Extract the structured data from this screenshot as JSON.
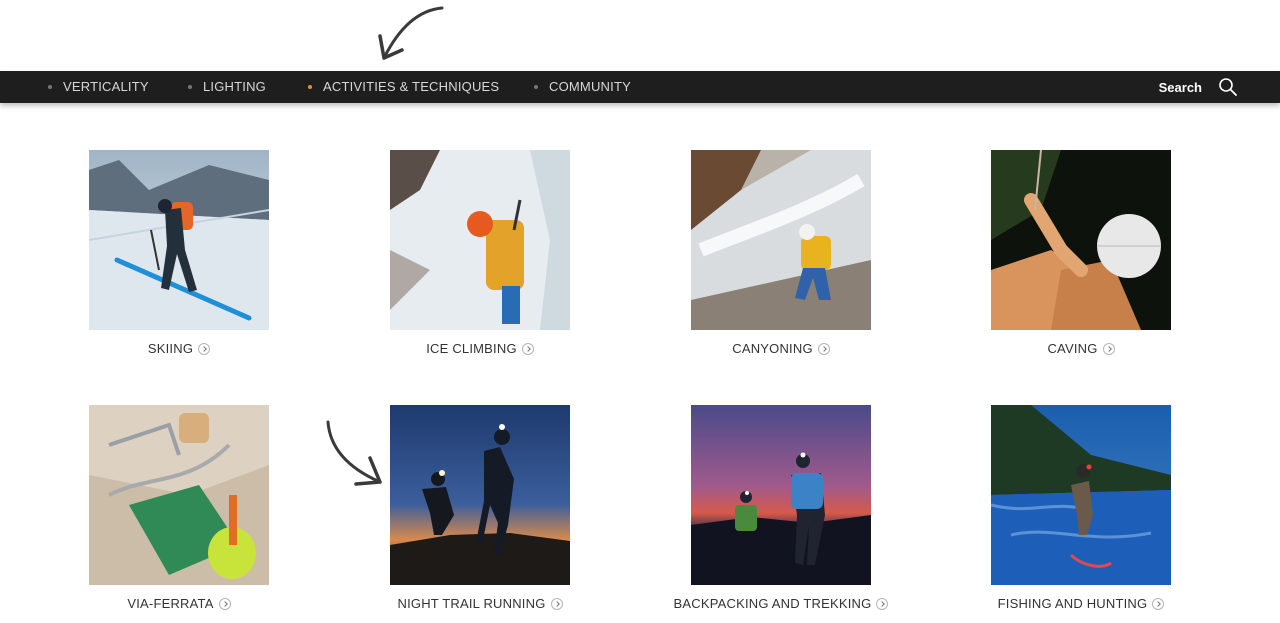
{
  "nav": {
    "items": [
      {
        "label": "VERTICALITY",
        "active": false
      },
      {
        "label": "LIGHTING",
        "active": false
      },
      {
        "label": "ACTIVITIES & TECHNIQUES",
        "active": true
      },
      {
        "label": "COMMUNITY",
        "active": false
      }
    ],
    "search_label": "Search",
    "active_color": "#e8922a",
    "background": "#1e1e1e"
  },
  "activities": [
    {
      "label": "SKIING",
      "icon": "chevron-right-icon"
    },
    {
      "label": "ICE CLIMBING",
      "icon": "chevron-right-icon"
    },
    {
      "label": "CANYONING",
      "icon": "chevron-right-icon"
    },
    {
      "label": "CAVING",
      "icon": "chevron-right-icon"
    },
    {
      "label": "VIA-FERRATA",
      "icon": "chevron-right-icon"
    },
    {
      "label": "NIGHT TRAIL RUNNING",
      "icon": "chevron-right-icon"
    },
    {
      "label": "BACKPACKING AND TREKKING",
      "icon": "chevron-right-icon"
    },
    {
      "label": "FISHING AND HUNTING",
      "icon": "chevron-right-icon"
    }
  ]
}
